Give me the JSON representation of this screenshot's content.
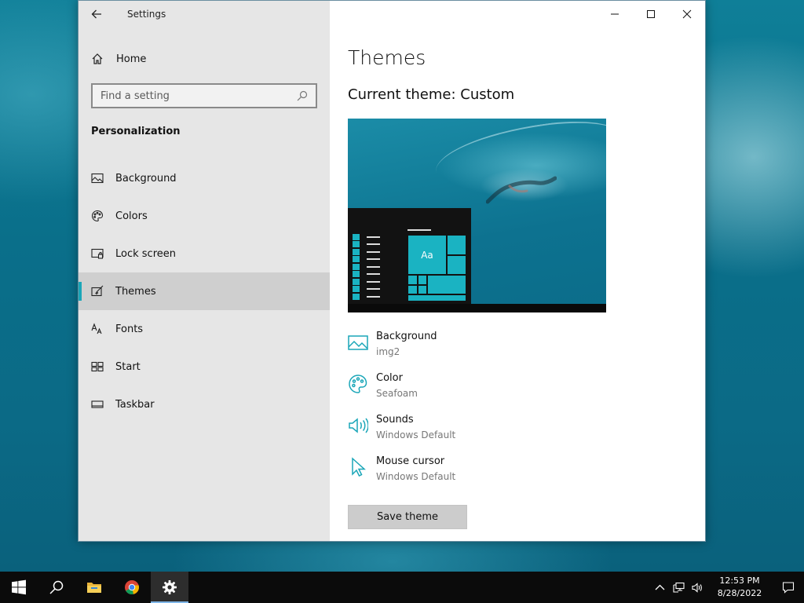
{
  "window": {
    "app_title": "Settings",
    "back_icon": "back-arrow-icon",
    "controls": [
      "minimize-icon",
      "maximize-icon",
      "close-icon"
    ]
  },
  "sidebar": {
    "home_label": "Home",
    "search_placeholder": "Find a setting",
    "section_title": "Personalization",
    "items": [
      {
        "label": "Background",
        "icon": "picture-icon",
        "active": false
      },
      {
        "label": "Colors",
        "icon": "palette-icon",
        "active": false
      },
      {
        "label": "Lock screen",
        "icon": "lock-screen-icon",
        "active": false
      },
      {
        "label": "Themes",
        "icon": "themes-brush-icon",
        "active": true
      },
      {
        "label": "Fonts",
        "icon": "font-icon",
        "active": false
      },
      {
        "label": "Start",
        "icon": "start-tiles-icon",
        "active": false
      },
      {
        "label": "Taskbar",
        "icon": "taskbar-icon",
        "active": false
      }
    ]
  },
  "main": {
    "title": "Themes",
    "current_theme": "Current theme: Custom",
    "preview_tile_text": "Aa",
    "properties": [
      {
        "name": "Background",
        "value": "img2",
        "icon": "picture-icon"
      },
      {
        "name": "Color",
        "value": "Seafoam",
        "icon": "palette-icon"
      },
      {
        "name": "Sounds",
        "value": "Windows Default",
        "icon": "speaker-icon"
      },
      {
        "name": "Mouse cursor",
        "value": "Windows Default",
        "icon": "cursor-icon"
      }
    ],
    "save_label": "Save theme"
  },
  "taskbar": {
    "apps": [
      "windows-start-icon",
      "search-icon",
      "file-explorer-icon",
      "chrome-icon",
      "settings-gear-icon"
    ],
    "time": "12:53 PM",
    "date": "8/28/2022"
  },
  "colors": {
    "accent": "#1aa6b8",
    "sidebar_bg": "#e6e6e6",
    "active_item_bg": "#cfcfcf",
    "taskbar_bg": "#0b0b0b"
  }
}
